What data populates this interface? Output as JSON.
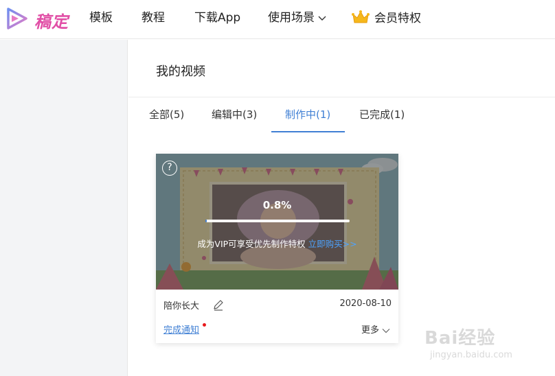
{
  "logo": {
    "text": "稿定"
  },
  "nav": {
    "templates": "模板",
    "tutorials": "教程",
    "download": "下载App",
    "scenarios": "使用场景",
    "vip": "会员特权"
  },
  "page": {
    "title": "我的视频"
  },
  "tabs": [
    {
      "label": "全部(5)"
    },
    {
      "label": "编辑中(3)"
    },
    {
      "label": "制作中(1)"
    },
    {
      "label": "已完成(1)"
    }
  ],
  "active_tab": 2,
  "video": {
    "progress_text": "0.8%",
    "progress": 0.008,
    "vip_text": "成为VIP可享受优先制作特权",
    "vip_link": "立即购买>>",
    "name": "陪你长大",
    "date": "2020-08-10",
    "notify_label": "完成通知",
    "more_label": "更多"
  },
  "watermark": {
    "brand": "Bai经验",
    "url": "jingyan.baidu.com"
  },
  "colors": {
    "accent": "#3f7fd4",
    "logo": "#e14fa6",
    "dot": "#e8191c"
  }
}
